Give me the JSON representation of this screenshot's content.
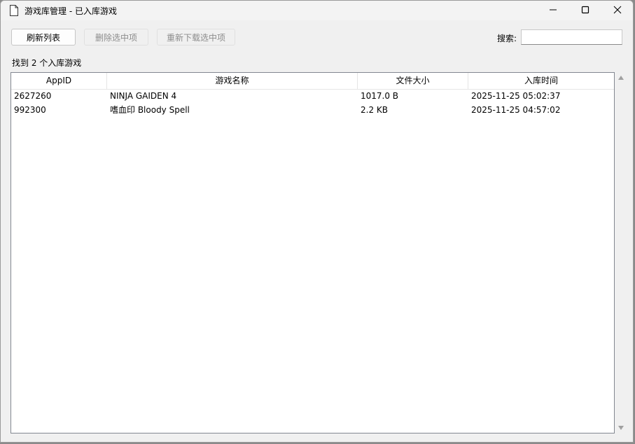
{
  "window": {
    "title": "游戏库管理 - 已入库游戏"
  },
  "toolbar": {
    "refresh_label": "刷新列表",
    "delete_label": "删除选中项",
    "redownload_label": "重新下载选中项",
    "search_label": "搜索:",
    "search_value": ""
  },
  "status": {
    "count_text": "找到 2 个入库游戏"
  },
  "table": {
    "headers": {
      "appid": "AppID",
      "name": "游戏名称",
      "size": "文件大小",
      "time": "入库时间"
    },
    "rows": [
      {
        "appid": "2627260",
        "name": "NINJA GAIDEN 4",
        "size": "1017.0 B",
        "time": "2025-11-25 05:02:37"
      },
      {
        "appid": "992300",
        "name": "嗜血印 Bloody Spell",
        "size": "2.2 KB",
        "time": "2025-11-25 04:57:02"
      }
    ]
  },
  "icons": {
    "app": "document-icon",
    "minimize": "minimize-icon",
    "maximize": "maximize-icon",
    "close": "close-icon",
    "scroll_up": "arrow-up-icon",
    "scroll_down": "arrow-down-icon"
  }
}
